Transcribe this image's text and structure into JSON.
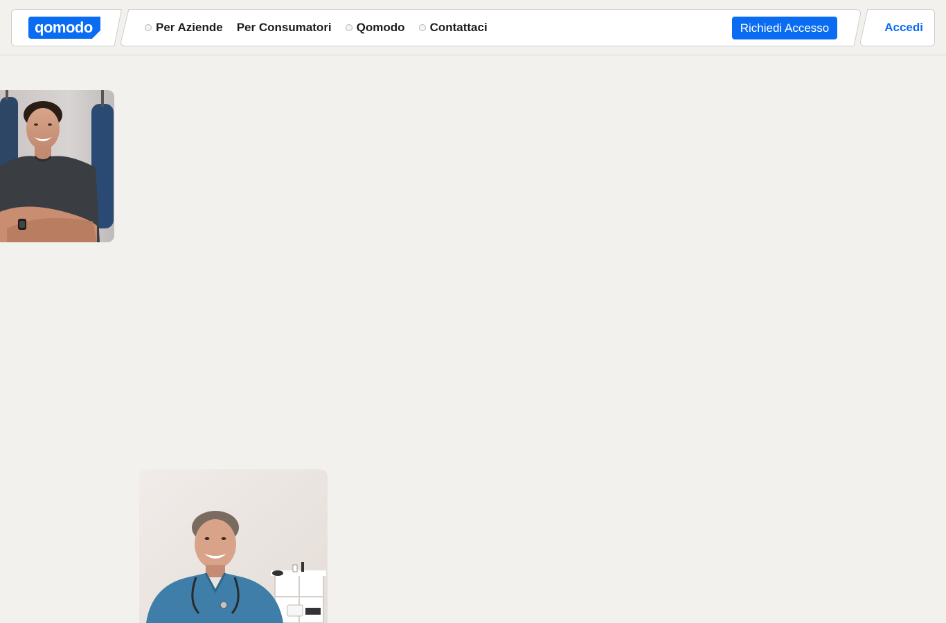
{
  "brand": {
    "logo_text": "qomodo",
    "accent_color": "#0a6cf2"
  },
  "nav": {
    "items": [
      {
        "label": "Per Aziende",
        "has_dot": true
      },
      {
        "label": "Per Consumatori",
        "has_dot": false
      },
      {
        "label": "Qomodo",
        "has_dot": true
      },
      {
        "label": "Contattaci",
        "has_dot": true
      }
    ],
    "cta_label": "Richiedi Accesso",
    "login_label": "Accedi"
  },
  "images": [
    {
      "subject": "smiling young man in grey t-shirt, arms crossed, in a gym"
    },
    {
      "subject": "smiling doctor in blue scrubs with stethoscope in a clinic"
    }
  ]
}
